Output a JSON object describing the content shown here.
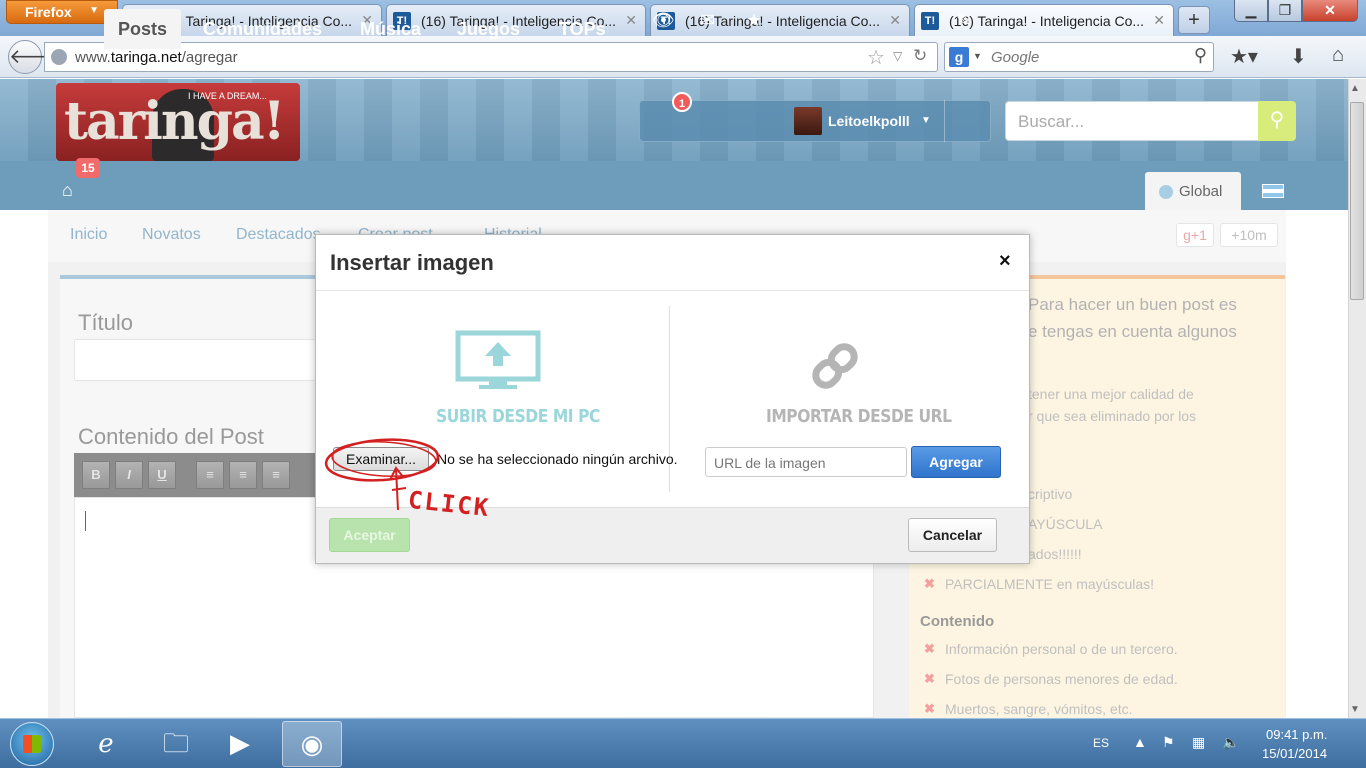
{
  "browser": {
    "menu_label": "Firefox",
    "tabs": [
      {
        "title": "(16) Taringa! - Inteligencia Co...",
        "favicon": "T!"
      },
      {
        "title": "(16) Taringa! - Inteligencia Co...",
        "favicon": "T!"
      },
      {
        "title": "(16) Taringa! - Inteligencia Co...",
        "favicon": "T!"
      },
      {
        "title": "(16) Taringa! - Inteligencia Co...",
        "favicon": "T!"
      }
    ],
    "url_prefix": "www.",
    "url_host": "taringa.net",
    "url_path": "/agregar",
    "search_placeholder": "Google",
    "search_engine_letter": "g"
  },
  "site": {
    "logo_text": "taringa!",
    "logo_subtext": "I HAVE A DREAM...",
    "notification_count": "1",
    "username": "Leitoelkpolll",
    "search_placeholder": "Buscar...",
    "home_badge": "15",
    "nav_tabs": [
      "Posts",
      "Comunidades",
      "Música",
      "Juegos",
      "TOPs"
    ],
    "global_label": "Global",
    "sub_nav": [
      "Inicio",
      "Novatos",
      "Destacados",
      "Crear post",
      "Historial"
    ],
    "gplus_label": "+1",
    "gplus_count": "+10m"
  },
  "editor": {
    "title_label": "Título",
    "content_label": "Contenido del Post",
    "toolbar_buttons": [
      "B",
      "I",
      "U",
      "≡",
      "≡",
      "≡"
    ]
  },
  "tips": {
    "heading_line1": "Para hacer un buen post es",
    "heading_line2": "e tengas en cuenta algunos",
    "para_line1": "tener una mejor calidad de",
    "para_line2": "r que sea eliminado por los",
    "items_title": [
      "criptivo",
      "AYÚSCULA",
      "ados!!!!!!",
      "PARCIALMENTE en mayúsculas!"
    ],
    "section_contenido": "Contenido",
    "items_contenido": [
      "Información personal o de un tercero.",
      "Fotos de personas menores de edad.",
      "Muertos, sangre, vómitos, etc."
    ]
  },
  "modal": {
    "title": "Insertar imagen",
    "close_symbol": "×",
    "upload_caption": "SUBIR DESDE MI PC",
    "import_caption": "IMPORTAR DESDE URL",
    "browse_label": "Examinar...",
    "no_file_text": "No se ha seleccionado ningún archivo.",
    "url_placeholder": "URL de la imagen",
    "add_label": "Agregar",
    "accept_label": "Aceptar",
    "cancel_label": "Cancelar",
    "annotation_text": "CLICK",
    "colors": {
      "upload_icon": "#9ad6da",
      "link_icon": "#b5b5b5",
      "annotation": "#d42020",
      "add_button": "#2f74cc"
    }
  },
  "taskbar": {
    "language": "ES",
    "time": "09:41 p.m.",
    "date": "15/01/2014"
  }
}
